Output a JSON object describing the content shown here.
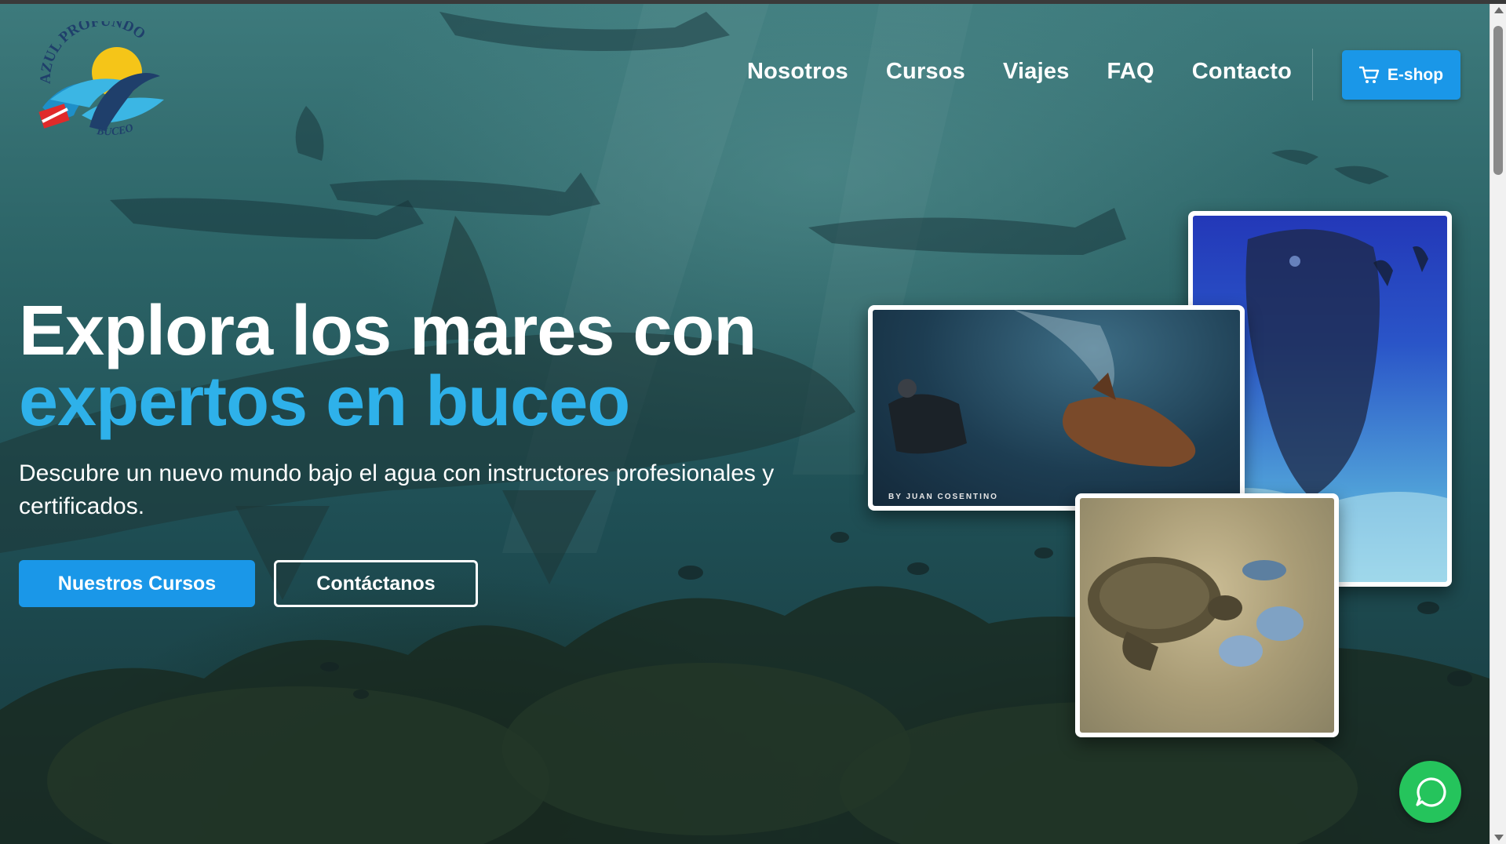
{
  "logo": {
    "brand_top": "AZUL PROFUNDO",
    "brand_bottom": "BUCEO"
  },
  "nav": {
    "items": [
      "Nosotros",
      "Cursos",
      "Viajes",
      "FAQ",
      "Contacto"
    ],
    "eshop_label": "E-shop",
    "eshop_icon": "cart-icon"
  },
  "hero": {
    "headline_line1": "Explora los mares con",
    "headline_line2": "expertos en buceo",
    "subtitle": "Descubre un nuevo mundo bajo el agua con instructores profesionales y certificados.",
    "primary_button": "Nuestros Cursos",
    "secondary_button": "Contáctanos"
  },
  "gallery": {
    "photo_credit": "BY JUAN COSENTINO"
  },
  "chat": {
    "icon": "chat-bubble-icon"
  },
  "colors": {
    "accent_blue": "#1a97e8",
    "headline_highlight": "#2eb1ea",
    "chat_green": "#25c45c"
  }
}
